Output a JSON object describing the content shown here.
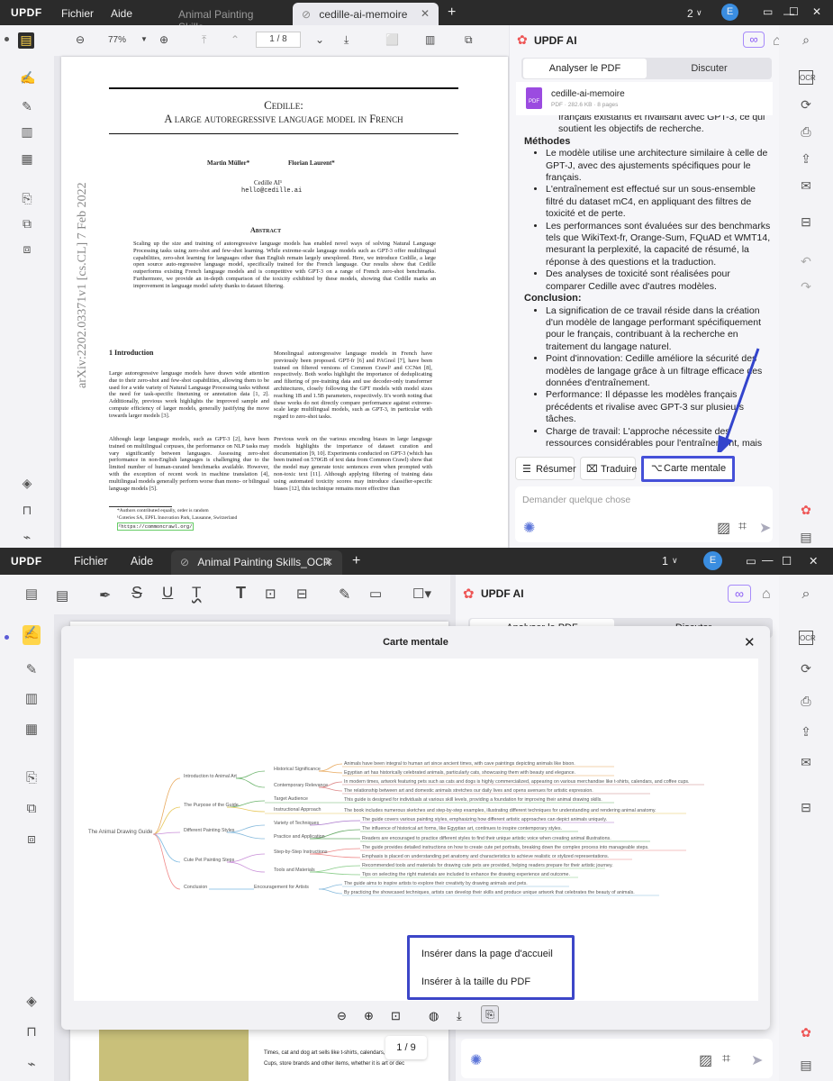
{
  "top": {
    "app_logo": "UPDF",
    "menu": {
      "file": "Fichier",
      "help": "Aide"
    },
    "tabs": [
      {
        "label": "Animal Painting Skills"
      },
      {
        "label": "cedille-ai-memoire"
      }
    ],
    "tab_add": "+",
    "window_count": "2",
    "avatar": "E",
    "zoom": "77%",
    "page_indicator": "1 / 8",
    "pdf": {
      "title_line1": "Cedille:",
      "title_line2": "A large autoregressive language model in French",
      "author1": "Martin Müller*",
      "author2": "Florian Laurent*",
      "affil": "Cedille AI¹",
      "email": "hello@cedille.ai",
      "abstract_title": "Abstract",
      "abstract": "Scaling up the size and training of autoregressive language models has enabled novel ways of solving Natural Language Processing tasks using zero-shot and few-shot learning. While extreme-scale language models such as GPT-3 offer multilingual capabilities, zero-shot learning for languages other than English remain largely unexplored. Here, we introduce Cedille, a large open source auto-regressive language model, specifically trained for the French language. Our results show that Cedille outperforms existing French language models and is competitive with GPT-3 on a range of French zero-shot benchmarks. Furthermore, we provide an in-depth comparison of the toxicity exhibited by these models, showing that Cedille marks an improvement in language model safety thanks to dataset filtering.",
      "arxiv": "arXiv:2202.03371v1 [cs.CL] 7 Feb 2022",
      "section": "1 Introduction",
      "col1": "Large autoregressive language models have drawn wide attention due to their zero-shot and few-shot capabilities, allowing them to be used for a wide variety of Natural Language Processing tasks without the need for task-specific finetuning or annotation data [1, 2]. Additionally, previous work highlights the improved sample and compute efficiency of larger models, generally justifying the move towards larger models [3].",
      "col1b": "Although large language models, such as GPT-3 [2], have been trained on multilingual corpuses, the performance on NLP tasks may vary significantly between languages. Assessing zero-shot performance in non-English languages is challenging due to the limited number of human-curated benchmarks available. However, with the exception of recent work in machine translation [4], multilingual models generally perform worse than mono- or bilingual language models [5].",
      "col2": "Monolingual autoregressive language models in French have previously been proposed. GPT-fr [6] and PAGnol [7], have been trained on filtered versions of Common Crawl² and CCNet [8], respectively. Both works highlight the importance of deduplicating and filtering of pre-training data and use decoder-only transformer architectures, closely following the GPT models with model sizes reaching 1B and 1.5B parameters, respectively. It's worth noting that these works do not directly compare performance against extreme-scale large multilingual models, such as GPT-3, in particular with regard to zero-shot tasks.",
      "col2b": "Previous work on the various encoding biases in large language models highlights the importance of dataset curation and documentation [9, 10]. Experiments conducted on GPT-3 (which has been trained on 570GB of text data from Common Crawl) show that the model may generate toxic sentences even when prompted with non-toxic text [11]. Although applying filtering of training data using automated toxicity scores may introduce classifier-specific biases [12], this technique remains more effective than",
      "foot1": "*Authors contributed equally, order is random",
      "foot2": "¹Coteries SA, EPFL Innovation Park, Lausanne, Switzerland",
      "foot3": "²https://commoncrawl.org/"
    },
    "ai": {
      "title": "UPDF AI",
      "tab_analyze": "Analyser le PDF",
      "tab_discuss": "Discuter",
      "file_name": "cedille-ai-memoire",
      "file_meta": "PDF · 282.6 KB · 8 pages",
      "pdf_badge": "PDF",
      "cut_line": "français existants et rivalisant avec GPT-3, ce qui",
      "cut_line2": "soutient les objectifs de recherche.",
      "methods_head": "Méthodes",
      "methods": [
        "Le modèle utilise une architecture similaire à celle de GPT-J, avec des ajustements spécifiques pour le français.",
        "L'entraînement est effectué sur un sous-ensemble filtré du dataset mC4, en appliquant des filtres de toxicité et de perte.",
        "Les performances sont évaluées sur des benchmarks tels que WikiText-fr, Orange-Sum, FQuAD et WMT14, mesurant la perplexité, la capacité de résumé, la réponse à des questions et la traduction.",
        "Des analyses de toxicité sont réalisées pour comparer Cedille avec d'autres modèles."
      ],
      "conclusion_head": "Conclusion:",
      "conclusion": [
        "La signification de ce travail réside dans la création d'un modèle de langage performant spécifiquement pour le français, contribuant à la recherche en traitement du langage naturel.",
        "Point d'innovation: Cedille améliore la sécurité des modèles de langage grâce à un filtrage efficace des données d'entraînement.",
        "Performance: Il dépasse les modèles français précédents et rivalise avec GPT-3 sur plusieurs tâches.",
        "Charge de travail: L'approche nécessite des ressources considérables pour l'entraînement, mais démontre une efficacité dans l'utilisation des données."
      ],
      "btn_summary": "Résumer",
      "btn_translate": "Traduire",
      "btn_mindmap": "Carte mentale",
      "ask_placeholder": "Demander quelque chose"
    }
  },
  "bottom": {
    "app_logo": "UPDF",
    "menu": {
      "file": "Fichier",
      "help": "Aide"
    },
    "tab": "Animal Painting Skills_OCR",
    "tab_add": "+",
    "window_count": "1",
    "avatar": "E",
    "ai_title": "UPDF AI",
    "ai_tab_analyze": "Analyser le PDF",
    "ai_tab_discuss": "Discuter",
    "modal_title": "Carte mentale",
    "page_indicator": "1 / 9",
    "menu_insert_home": "Insérer dans la page d'accueil",
    "menu_insert_pdf": "Insérer à la taille du PDF",
    "behind_text1": "Times, cat and dog art sells like t-shirts, calendars, coff",
    "behind_text2": "Cups, store brands and other items, whether it is art or dec",
    "mindmap": {
      "root": "The Animal Drawing Guide",
      "branches": [
        {
          "label": "Introduction to Animal Art"
        },
        {
          "label": "The Purpose of the Guide"
        },
        {
          "label": "Different Painting Styles"
        },
        {
          "label": "Cute Pet Painting Steps"
        },
        {
          "label": "Conclusion"
        }
      ],
      "subs": [
        "Historical Significance",
        "Contemporary Relevance",
        "Target Audience",
        "Instructional Approach",
        "Variety of Techniques",
        "Practice and Application",
        "Step-by-Step Instructions",
        "Tools and Materials",
        "Encouragement for Artists"
      ],
      "leaves": [
        "Animals have been integral to human art since ancient times, with cave paintings depicting animals like bison.",
        "Egyptian art has historically celebrated animals, particularly cats, showcasing them with beauty and elegance.",
        "In modern times, artwork featuring pets such as cats and dogs is highly commercialized, appearing on various merchandise like t-shirts, calendars, and coffee cups.",
        "The relationship between art and domestic animals stretches our daily lives and opens avenues for artistic expression.",
        "This guide is designed for individuals at various skill levels, providing a foundation for improving their animal drawing skills.",
        "The book includes numerous sketches and step-by-step examples, illustrating different techniques for understanding and rendering animal anatomy.",
        "The guide covers various painting styles, emphasizing how different artistic approaches can depict animals uniquely.",
        "The influence of historical art forms, like Egyptian art, continues to inspire contemporary styles.",
        "Readers are encouraged to practice different styles to find their unique artistic voice when creating animal illustrations.",
        "The guide provides detailed instructions on how to create cute pet portraits, breaking down the complex process into manageable steps.",
        "Emphasis is placed on understanding pet anatomy and characteristics to achieve realistic or stylized representations.",
        "Recommended tools and materials for drawing cute pets are provided, helping readers prepare for their artistic journey.",
        "Tips on selecting the right materials are included to enhance the drawing experience and outcome.",
        "The guide aims to inspire artists to explore their creativity by drawing animals and pets.",
        "By practicing the showcased techniques, artists can develop their skills and produce unique artwork that celebrates the beauty of animals."
      ]
    }
  },
  "colors": {
    "accent": "#4550d8",
    "titlebar": "#2b2b2b",
    "panel": "#f3f3f6"
  }
}
